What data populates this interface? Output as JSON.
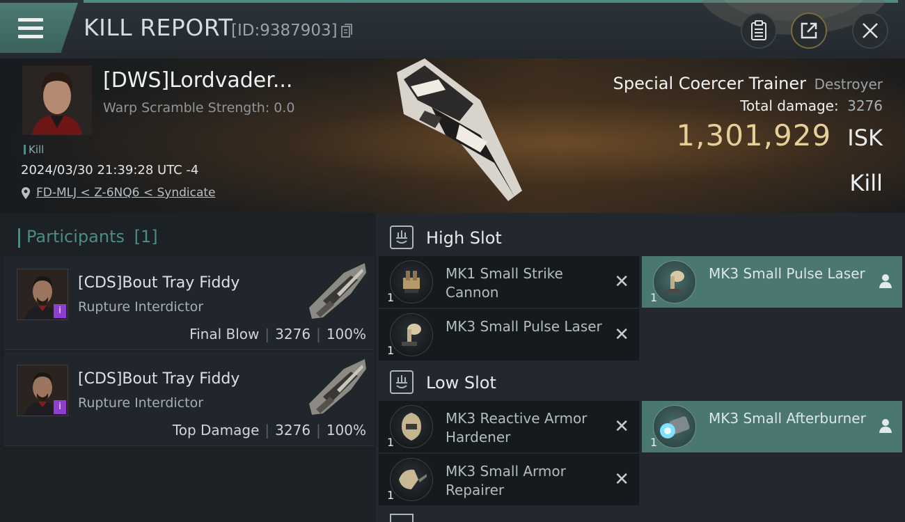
{
  "header": {
    "title": "KILL REPORT",
    "report_id": "[ID:9387903]",
    "icons": [
      "menu-icon",
      "copy-icon",
      "clipboard-icon",
      "share-icon",
      "close-icon"
    ]
  },
  "victim": {
    "name": "[DWS]Lordvader...",
    "warp_scramble": "Warp Scramble Strength: 0.0",
    "tag": "Kill",
    "datetime": "2024/03/30 21:39:28 UTC -4",
    "location": "FD-MLJ < Z-6NQ6 < Syndicate",
    "ship_name": "Special Coercer Trainer",
    "ship_class": "Destroyer",
    "total_damage_label": "Total damage:",
    "total_damage": "3276",
    "isk_value": "1,301,929",
    "isk_unit": "ISK",
    "outcome": "Kill"
  },
  "participants": {
    "label": "Participants",
    "count": "[1]",
    "rows": [
      {
        "name": "[CDS]Bout Tray Fiddy",
        "ship": "Rupture Interdictor",
        "role": "Final Blow",
        "damage": "3276",
        "percent": "100%",
        "badge": "i"
      },
      {
        "name": "[CDS]Bout Tray Fiddy",
        "ship": "Rupture Interdictor",
        "role": "Top Damage",
        "damage": "3276",
        "percent": "100%",
        "badge": "i"
      }
    ]
  },
  "fittings": {
    "high_slot_label": "High Slot",
    "low_slot_label": "Low Slot",
    "high": [
      {
        "name": "MK1 Small Strike Cannon",
        "qty": "1",
        "state": "destroyed"
      },
      {
        "name": "MK3 Small Pulse Laser",
        "qty": "1",
        "state": "dropped"
      },
      {
        "name": "MK3 Small Pulse Laser",
        "qty": "1",
        "state": "destroyed"
      }
    ],
    "low": [
      {
        "name": "MK3 Reactive Armor Hardener",
        "qty": "1",
        "state": "destroyed"
      },
      {
        "name": "MK3 Small Afterburner",
        "qty": "1",
        "state": "dropped"
      },
      {
        "name": "MK3 Small Armor Repairer",
        "qty": "1",
        "state": "destroyed"
      }
    ],
    "destroyed_mark": "✕",
    "colors": {
      "dropped_bg": "#4b7773",
      "destroyed_bg": "#151a1e",
      "accent": "#4f8a84",
      "isk": "#e6cf99"
    }
  }
}
